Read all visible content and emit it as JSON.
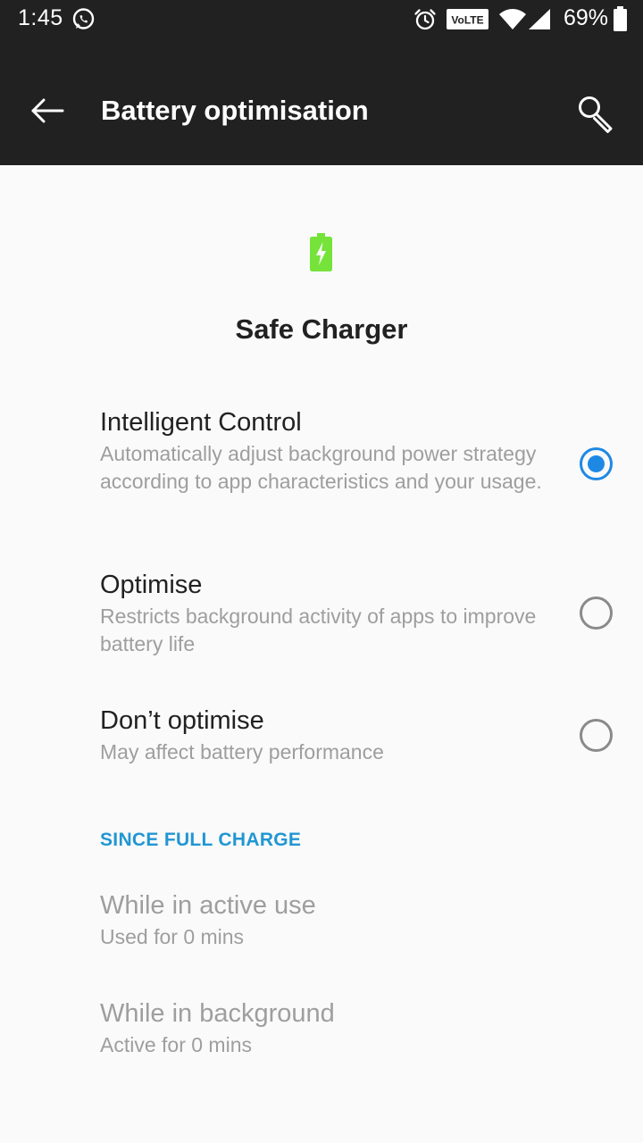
{
  "status_bar": {
    "time": "1:45",
    "battery_percent": "69%",
    "volte_label": "VoLTE",
    "icons": [
      "whatsapp-icon",
      "alarm-icon",
      "volte-icon",
      "wifi-icon",
      "signal-icon",
      "battery-icon"
    ]
  },
  "app_bar": {
    "title": "Battery optimisation",
    "back_icon": "back-arrow-icon",
    "search_icon": "search-icon"
  },
  "header": {
    "icon": "charging-battery-icon",
    "title": "Safe Charger",
    "icon_color": "#76e33a"
  },
  "options": [
    {
      "title": "Intelligent Control",
      "description": "Automatically adjust background power strategy according to app characteristics and your usage.",
      "selected": true
    },
    {
      "title": "Optimise",
      "description": "Restricts background activity of apps to improve battery life",
      "selected": false
    },
    {
      "title": "Don’t optimise",
      "description": "May affect battery performance",
      "selected": false
    }
  ],
  "since_full_charge": {
    "header": "SINCE FULL CHARGE",
    "rows": [
      {
        "title": "While in active use",
        "value": "Used for 0 mins"
      },
      {
        "title": "While in background",
        "value": "Active for 0 mins"
      }
    ]
  },
  "colors": {
    "accent": "#1e88e5",
    "section_header": "#2196d3",
    "bar_background": "#212121",
    "page_background": "#fafafa"
  }
}
